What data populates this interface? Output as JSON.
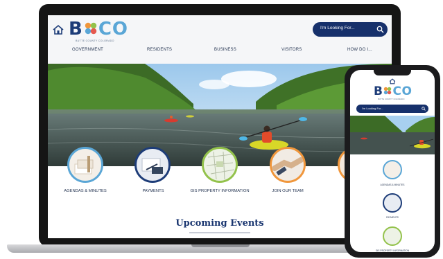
{
  "site": {
    "logo_text_b": "B",
    "logo_text_co": "CO",
    "logo_subtitle": "BUTTE COUNTY COLORADO",
    "search_placeholder": "I'm Looking For...",
    "nav": [
      "GOVERNMENT",
      "RESIDENTS",
      "BUSINESS",
      "VISITORS",
      "HOW DO I..."
    ],
    "tiles": [
      {
        "label": "AGENDAS & MINUTES",
        "icon": "agenda-icon"
      },
      {
        "label": "PAYMENTS",
        "icon": "payments-icon"
      },
      {
        "label": "GIS PROPERTY INFORMATION",
        "icon": "map-icon"
      },
      {
        "label": "JOIN OUR TEAM",
        "icon": "handshake-icon"
      }
    ],
    "section_title": "Upcoming Events"
  },
  "mobile": {
    "logo_text_b": "B",
    "logo_text_co": "CO",
    "logo_subtitle": "BUTTE COUNTY COLORADO",
    "search_placeholder": "I'm Looking For...",
    "tiles": [
      {
        "label": "AGENDAS & MINUTES"
      },
      {
        "label": "PAYMENTS"
      },
      {
        "label": "GIS PROPERTY INFORMATION"
      }
    ]
  },
  "colors": {
    "navy": "#16306b",
    "light_blue": "#5aa6d6",
    "orange": "#f0963b",
    "green": "#93c24b"
  }
}
